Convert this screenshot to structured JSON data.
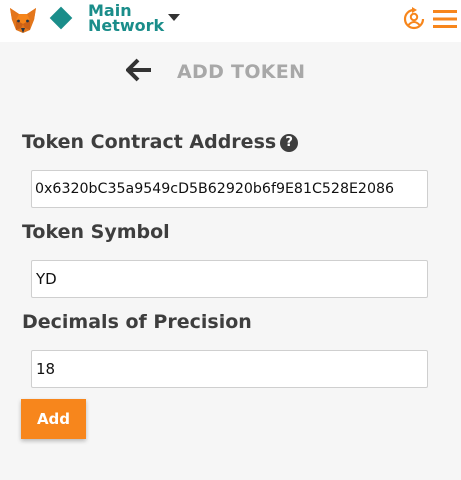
{
  "header": {
    "network_line1": "Main",
    "network_line2": "Network",
    "icons": {
      "logo": "metamask-fox-icon",
      "network": "network-diamond-icon",
      "dropdown": "chevron-down-icon",
      "account": "account-icon",
      "menu": "hamburger-menu-icon"
    },
    "colors": {
      "network": "#1a8d8a",
      "accent": "#f7861c"
    }
  },
  "page": {
    "title": "ADD TOKEN",
    "back_icon": "arrow-left-icon"
  },
  "form": {
    "contract_label": "Token Contract Address",
    "help_icon": "question-circle-icon",
    "contract_value": "0x6320bC35a9549cD5B62920b6f9E81C528E2086",
    "symbol_label": "Token Symbol",
    "symbol_value": "YD",
    "decimals_label": "Decimals of Precision",
    "decimals_value": "18",
    "submit_label": "Add"
  }
}
